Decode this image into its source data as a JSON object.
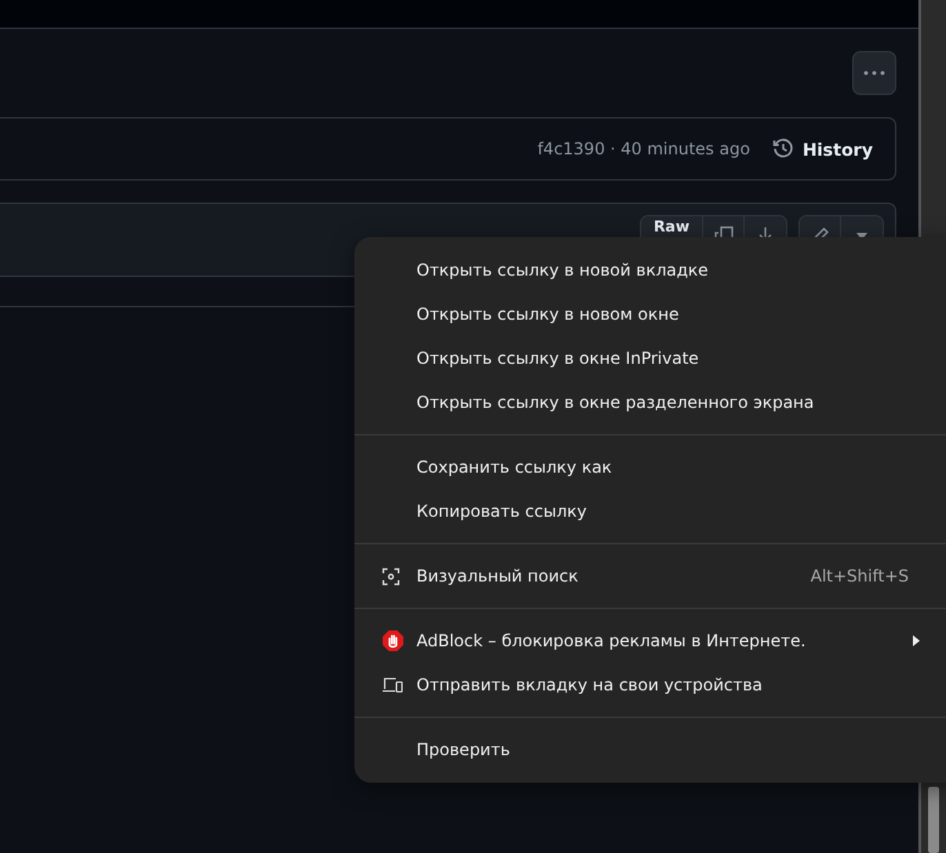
{
  "commit_bar": {
    "commit": "f4c1390 · 40 minutes ago",
    "history_button": "History"
  },
  "file_toolbar": {
    "raw_button": "Raw"
  },
  "context_menu": {
    "groups": [
      [
        {
          "kind": "plain",
          "label": "Открыть ссылку в новой вкладке"
        },
        {
          "kind": "plain",
          "label": "Открыть ссылку в новом окне"
        },
        {
          "kind": "plain",
          "label": "Открыть ссылку в окне InPrivate"
        },
        {
          "kind": "plain",
          "label": "Открыть ссылку в окне разделенного экрана"
        }
      ],
      [
        {
          "kind": "plain",
          "label": "Сохранить ссылку как"
        },
        {
          "kind": "plain",
          "label": "Копировать ссылку"
        }
      ],
      [
        {
          "kind": "visual-search",
          "label": "Визуальный поиск",
          "shortcut": "Alt+Shift+S"
        }
      ],
      [
        {
          "kind": "adblock",
          "label": "AdBlock – блокировка рекламы в Интернете.",
          "submenu": true
        },
        {
          "kind": "send-tab",
          "label": "Отправить вкладку на свои устройства"
        }
      ],
      [
        {
          "kind": "plain",
          "label": "Проверить"
        }
      ]
    ]
  }
}
